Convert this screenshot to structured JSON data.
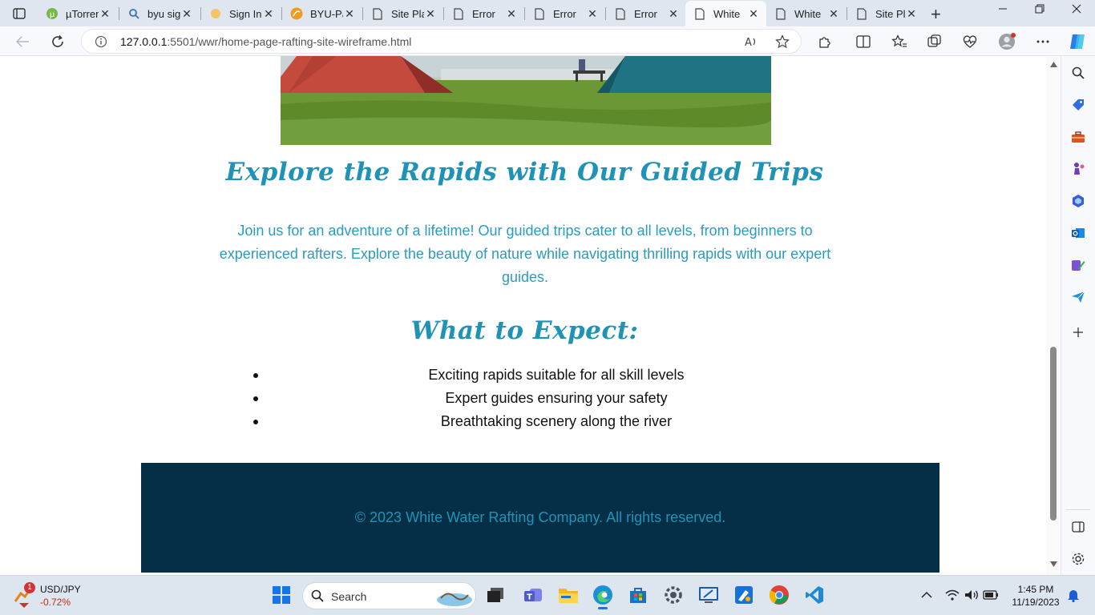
{
  "browser": {
    "tabs": [
      {
        "label": "µTorrent",
        "icon": "utorrent-icon",
        "active": false
      },
      {
        "label": "byu sig",
        "icon": "search-icon",
        "active": false
      },
      {
        "label": "Sign In",
        "icon": "sun-icon",
        "active": false
      },
      {
        "label": "BYU-Pa",
        "icon": "byu-pathway-icon",
        "active": false
      },
      {
        "label": "Site Pla",
        "icon": "page-icon",
        "active": false
      },
      {
        "label": "Error",
        "icon": "page-icon",
        "active": false
      },
      {
        "label": "Error",
        "icon": "page-icon",
        "active": false
      },
      {
        "label": "Error",
        "icon": "page-icon",
        "active": false
      },
      {
        "label": "White",
        "icon": "page-icon",
        "active": true
      },
      {
        "label": "White",
        "icon": "page-icon",
        "active": false
      },
      {
        "label": "Site Pla",
        "icon": "page-icon",
        "active": false
      }
    ],
    "close_glyph": "✕",
    "new_tab_glyph": "+",
    "address": {
      "host": "127.0.0.1",
      "path": ":5501/wwr/home-page-rafting-site-wireframe.html"
    }
  },
  "page": {
    "heading": "Explore the Rapids with Our Guided Trips",
    "intro": "Join us for an adventure of a lifetime! Our guided trips cater to all levels, from beginners to experienced rafters. Explore the beauty of nature while navigating thrilling rapids with our expert guides.",
    "expect_heading": "What to Expect:",
    "expect_items": [
      "Exciting rapids suitable for all skill levels",
      "Expert guides ensuring your safety",
      "Breathtaking scenery along the river"
    ],
    "footer": "© 2023 White Water Rafting Company. All rights reserved.",
    "colors": {
      "accent": "#1f93b6",
      "footer_bg": "#042f46"
    }
  },
  "taskbar": {
    "ticker_symbol": "USD/JPY",
    "ticker_change": "-0.72%",
    "notification_count": "1",
    "search_placeholder": "Search",
    "time": "1:45 PM",
    "date": "11/19/2023"
  }
}
